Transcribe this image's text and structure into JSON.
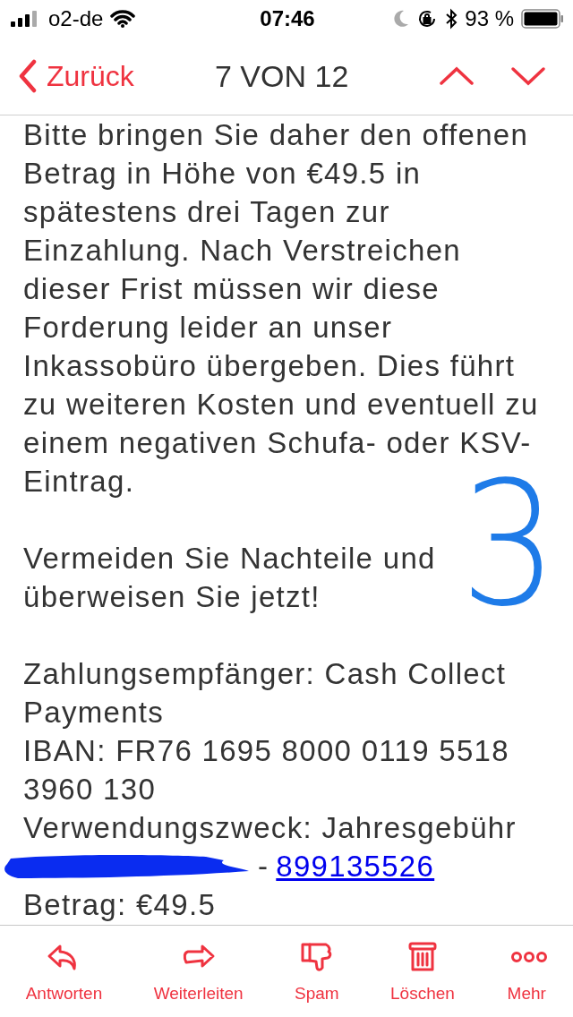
{
  "status_bar": {
    "carrier": "o2-de",
    "time": "07:46",
    "battery": "93 %"
  },
  "nav": {
    "back": "Zurück",
    "title": "7 VON 12"
  },
  "body": {
    "paragraphs": [
      "Bitte bringen Sie daher den offenen Betrag in Höhe von €49.5 in spätestens drei Tagen zur Einzahlung. Nach Verstreichen dieser Frist müssen wir diese Forderung leider an unser Inkassobüro übergeben. Dies führt zu weiteren Kosten und eventuell zu einem negativen Schufa- oder KSV-Eintrag.",
      "Vermeiden Sie Nachteile und überweisen Sie jetzt!"
    ],
    "details": [
      "Zahlungsempfänger: Cash Collect Payments",
      "IBAN: FR76 1695 8000 0119 5518 3960 130",
      "Verwendungszweck: Jahresgebühr"
    ],
    "reference": {
      "separator": "-",
      "link": "899135526"
    },
    "amount": "Betrag: €49.5",
    "annotation": "3"
  },
  "toolbar": [
    {
      "kind": "reply",
      "label": "Antworten"
    },
    {
      "kind": "forward",
      "label": "Weiterleiten"
    },
    {
      "kind": "spam",
      "label": "Spam"
    },
    {
      "kind": "trash",
      "label": "Löschen"
    },
    {
      "kind": "more",
      "label": "Mehr"
    }
  ]
}
